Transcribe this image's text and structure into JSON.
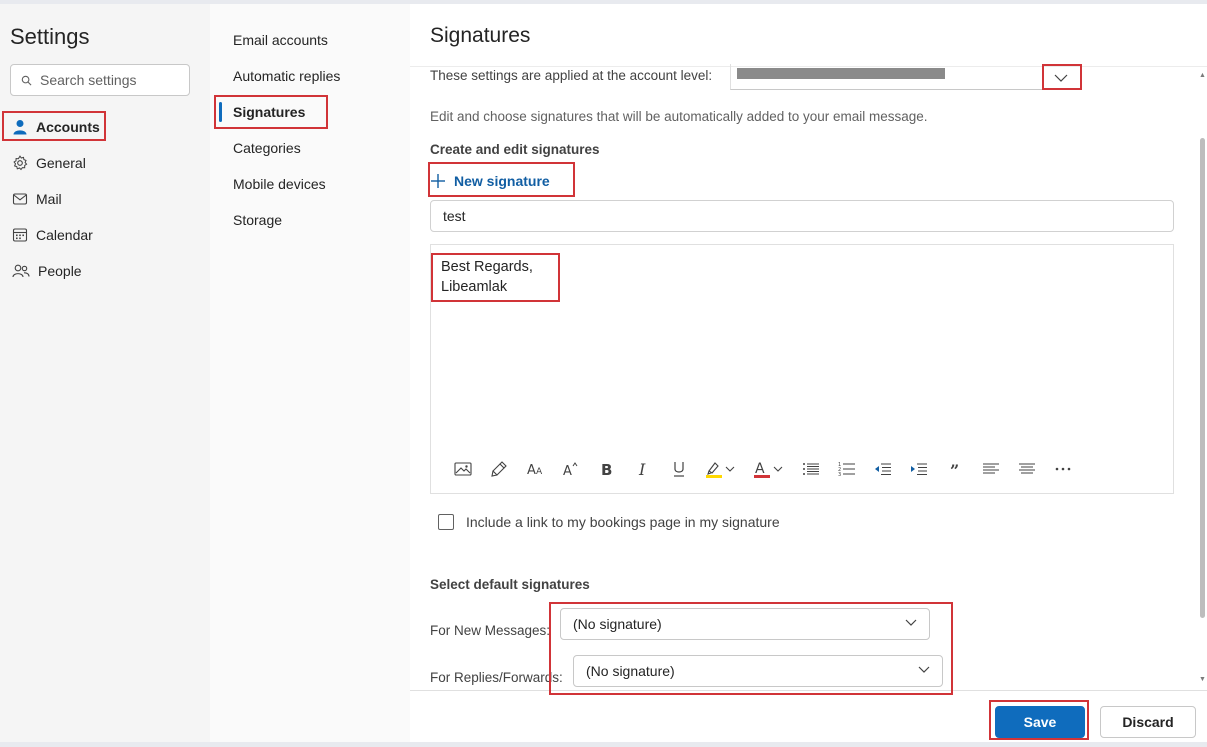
{
  "sidebar": {
    "title": "Settings",
    "search_placeholder": "Search settings",
    "items": [
      {
        "label": "Accounts",
        "icon": "person-icon"
      },
      {
        "label": "General",
        "icon": "gear-icon"
      },
      {
        "label": "Mail",
        "icon": "mail-icon"
      },
      {
        "label": "Calendar",
        "icon": "calendar-icon"
      },
      {
        "label": "People",
        "icon": "people-icon"
      }
    ]
  },
  "subnav": {
    "items": [
      {
        "label": "Email accounts"
      },
      {
        "label": "Automatic replies"
      },
      {
        "label": "Signatures"
      },
      {
        "label": "Categories"
      },
      {
        "label": "Mobile devices"
      },
      {
        "label": "Storage"
      }
    ]
  },
  "main": {
    "title": "Signatures",
    "account_level_label": "These settings are applied at the account level:",
    "description": "Edit and choose signatures that will be automatically added to your email message.",
    "create_section_title": "Create and edit signatures",
    "new_signature_label": "New signature",
    "signature_name": "test",
    "signature_lines": [
      "Best Regards,",
      "Libeamlak"
    ],
    "toolbar_icons": [
      "insert-picture-icon",
      "format-painter-icon",
      "font-size-icon",
      "grow-font-icon",
      "bold-icon",
      "italic-icon",
      "underline-icon",
      "highlight-icon",
      "font-color-icon",
      "bullets-icon",
      "numbering-icon",
      "decrease-indent-icon",
      "increase-indent-icon",
      "quote-icon",
      "align-left-icon",
      "align-center-icon",
      "more-options-icon"
    ],
    "bookings_label": "Include a link to my bookings page in my signature",
    "default_section_title": "Select default signatures",
    "new_messages_label": "For New Messages:",
    "new_messages_value": "(No signature)",
    "replies_label": "For Replies/Forwards:",
    "replies_value": "(No signature)"
  },
  "footer": {
    "save_label": "Save",
    "discard_label": "Discard"
  },
  "colors": {
    "accent": "#0f6cbd",
    "annotation": "#d13438",
    "highlight_yellow": "#ffd800",
    "font_red": "#d13438"
  }
}
